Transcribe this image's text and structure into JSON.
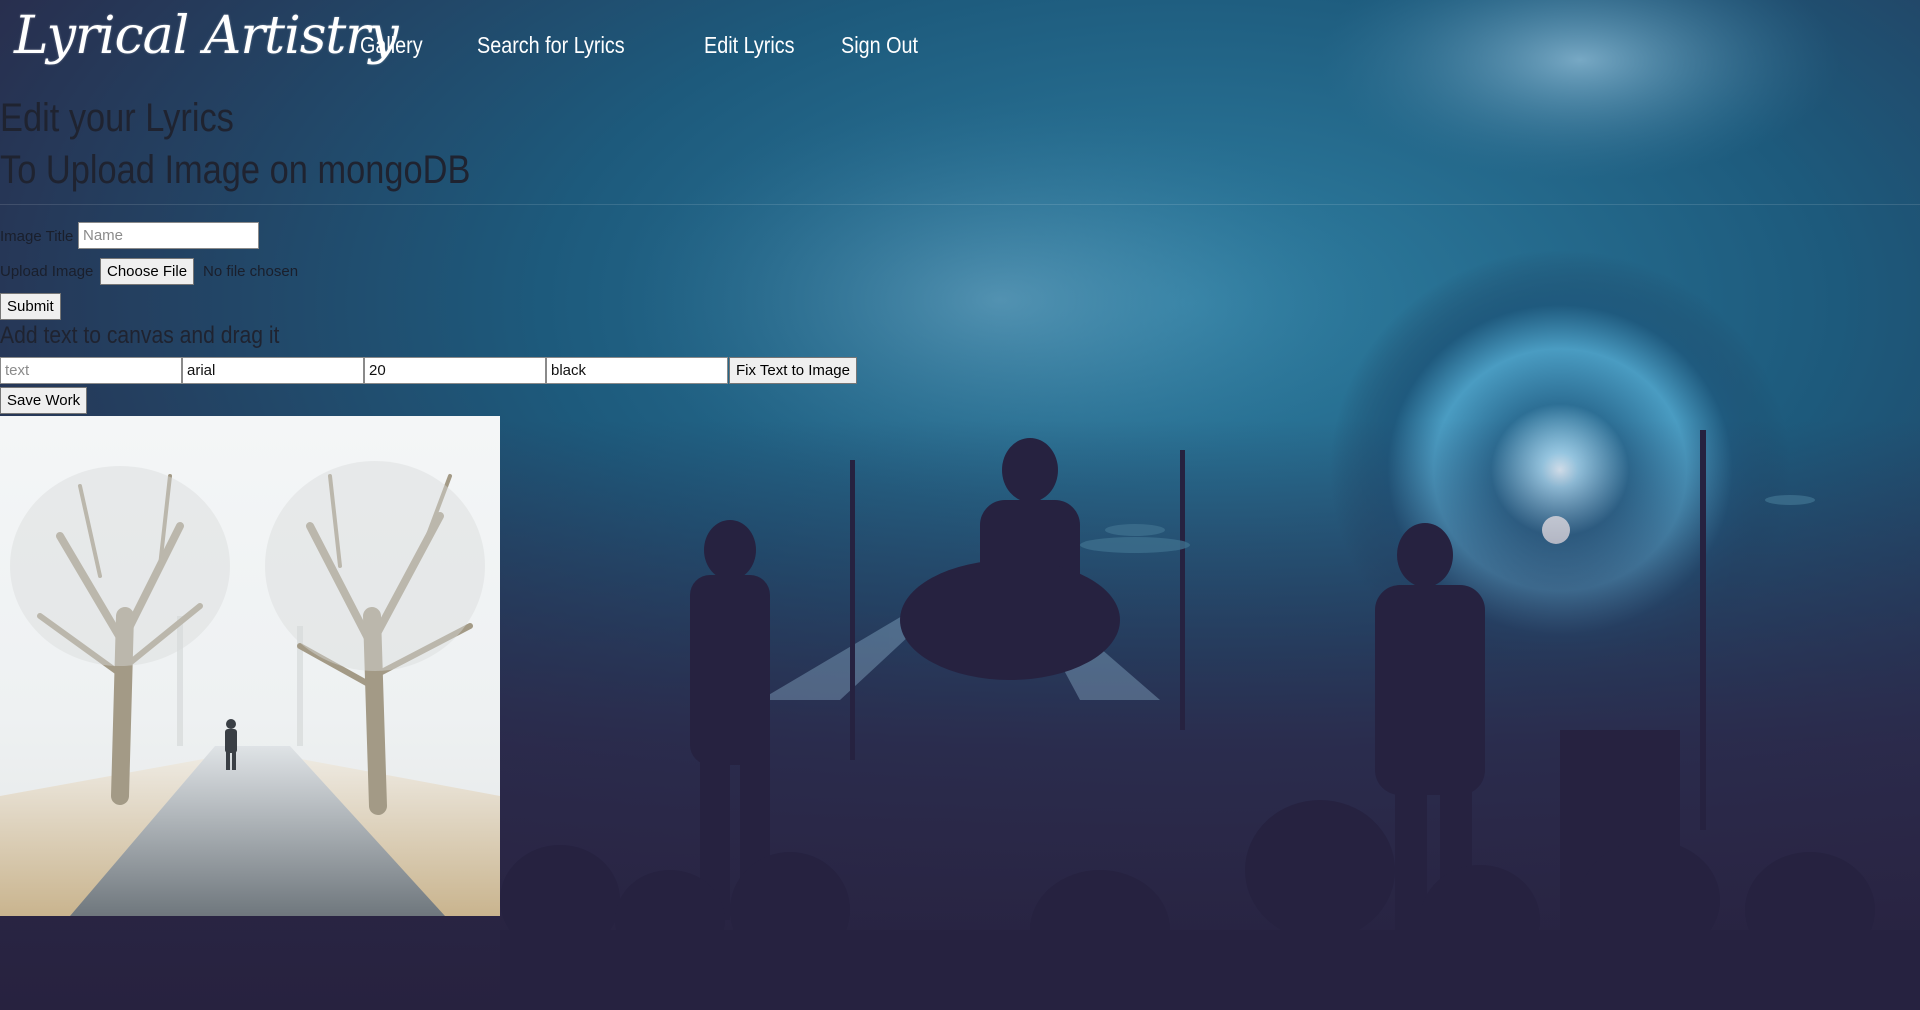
{
  "nav": {
    "brand": "Lyrical Artistry",
    "links": [
      "Gallery",
      "Search for Lyrics",
      "Edit Lyrics",
      "Sign Out"
    ]
  },
  "page": {
    "heading": "Edit your Lyrics",
    "subheading": "To Upload Image on mongoDB"
  },
  "upload_form": {
    "title_label": "Image Title",
    "title_placeholder": "Name",
    "upload_label": "Upload Image",
    "choose_file_label": "Choose File",
    "no_file_text": "No file chosen",
    "submit_label": "Submit"
  },
  "text_tool": {
    "heading": "Add text to canvas and drag it",
    "text_placeholder": "text",
    "font_value": "arial",
    "size_value": "20",
    "color_value": "black",
    "fix_button_label": "Fix Text to Image",
    "save_button_label": "Save Work"
  },
  "colors": {
    "text_dark": "#1f2330",
    "nav_text": "#ffffff",
    "bg_dark": "#2c2748",
    "bg_blue": "#1f6a8c"
  }
}
